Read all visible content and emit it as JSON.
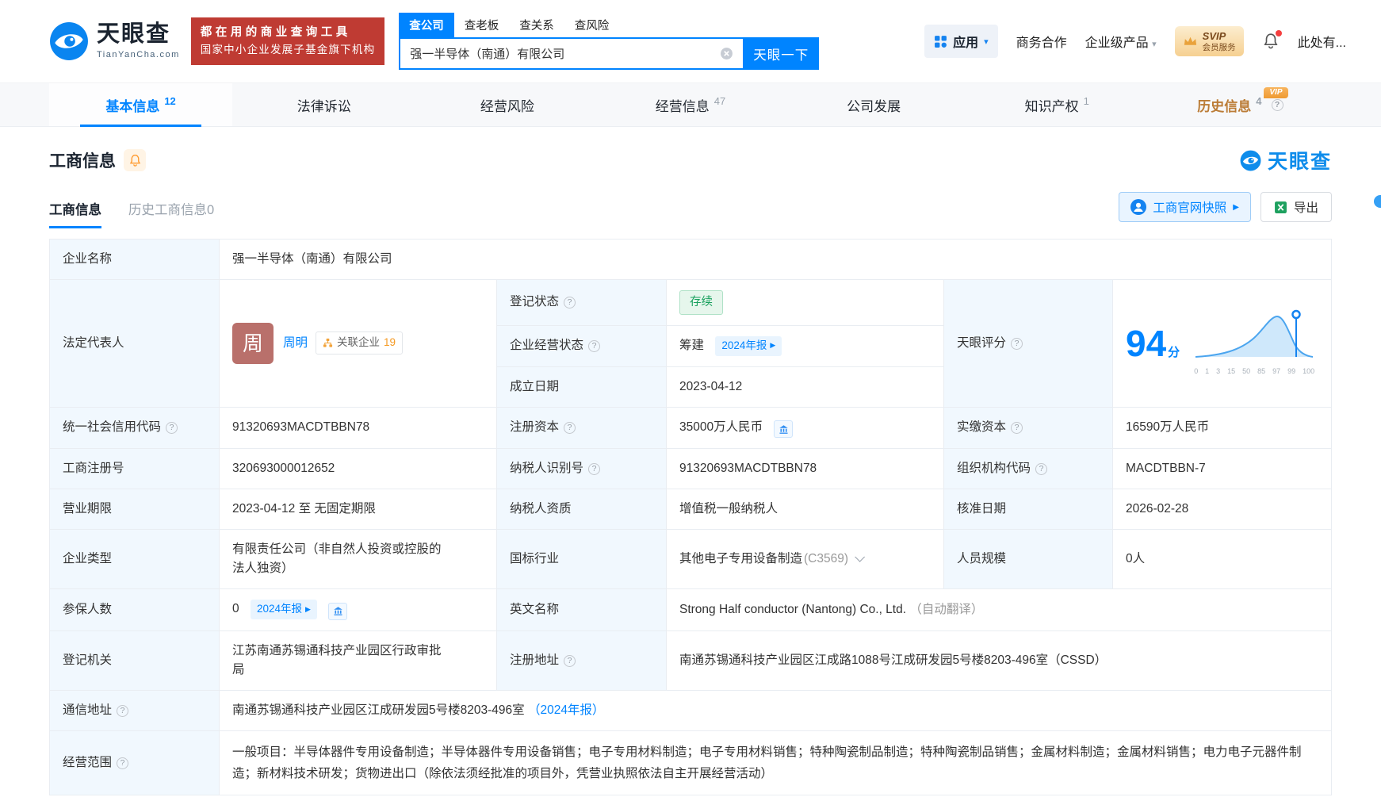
{
  "icons": {
    "help": "?",
    "caret": "▾",
    "play": "▶",
    "clear": "×"
  },
  "header": {
    "logo": {
      "cn": "天眼查",
      "en": "TianYanCha.com"
    },
    "banner": {
      "line1": "都在用的商业查询工具",
      "line2": "国家中小企业发展子基金旗下机构"
    },
    "search": {
      "tabs": [
        {
          "label": "查公司"
        },
        {
          "label": "查老板"
        },
        {
          "label": "查关系"
        },
        {
          "label": "查风险"
        }
      ],
      "value": "强一半导体（南通）有限公司",
      "button": "天眼一下"
    },
    "menu": {
      "apps": "应用",
      "cooperation": "商务合作",
      "products": "企业级产品",
      "svip_line1": "SVIP",
      "svip_line2": "会员服务",
      "more": "此处有..."
    }
  },
  "nav_tabs": [
    {
      "label": "基本信息",
      "count": "12"
    },
    {
      "label": "法律诉讼",
      "count": ""
    },
    {
      "label": "经营风险",
      "count": ""
    },
    {
      "label": "经营信息",
      "count": "47"
    },
    {
      "label": "公司发展",
      "count": ""
    },
    {
      "label": "知识产权",
      "count": "1"
    },
    {
      "label": "历史信息",
      "count": "4",
      "badge": "VIP"
    }
  ],
  "section": {
    "title": "工商信息",
    "brand": "天眼查",
    "subtabs": [
      {
        "label": "工商信息"
      },
      {
        "label": "历史工商信息0"
      }
    ],
    "snapshot_button": "工商官网快照",
    "export_button": "导出"
  },
  "info": {
    "company_name": {
      "label": "企业名称",
      "value": "强一半导体（南通）有限公司"
    },
    "legal_rep": {
      "label": "法定代表人",
      "avatar": "周",
      "name": "周明",
      "related_label": "关联企业",
      "related_count": "19"
    },
    "reg_status": {
      "label": "登记状态",
      "value": "存续"
    },
    "operating_status": {
      "label": "企业经营状态",
      "value": "筹建",
      "report_tag": "2024年报"
    },
    "establish_date": {
      "label": "成立日期",
      "value": "2023-04-12"
    },
    "score": {
      "label": "天眼评分",
      "value": "94",
      "unit": "分",
      "axis": [
        "0",
        "1",
        "3",
        "15",
        "50",
        "85",
        "97",
        "99",
        "100"
      ]
    },
    "credit_code": {
      "label": "统一社会信用代码",
      "value": "91320693MACDTBBN78"
    },
    "registered_capital": {
      "label": "注册资本",
      "value": "35000万人民币"
    },
    "paid_in_capital": {
      "label": "实缴资本",
      "value": "16590万人民币"
    },
    "registration_number": {
      "label": "工商注册号",
      "value": "320693000012652"
    },
    "taxpayer_id": {
      "label": "纳税人识别号",
      "value": "91320693MACDTBBN78"
    },
    "org_code": {
      "label": "组织机构代码",
      "value": "MACDTBBN-7"
    },
    "business_term": {
      "label": "营业期限",
      "value": "2023-04-12 至 无固定期限"
    },
    "taxpayer_qualification": {
      "label": "纳税人资质",
      "value": "增值税一般纳税人"
    },
    "approval_date": {
      "label": "核准日期",
      "value": "2026-02-28"
    },
    "company_type": {
      "label": "企业类型",
      "value": "有限责任公司（非自然人投资或控股的法人独资）"
    },
    "industry": {
      "label": "国标行业",
      "value": "其他电子专用设备制造",
      "code": "(C3569)"
    },
    "staff_size": {
      "label": "人员规模",
      "value": "0人"
    },
    "insured_count": {
      "label": "参保人数",
      "value": "0",
      "report_tag": "2024年报"
    },
    "english_name": {
      "label": "英文名称",
      "value": "Strong Half conductor (Nantong) Co., Ltd.",
      "note": "（自动翻译）"
    },
    "registration_authority": {
      "label": "登记机关",
      "value": "江苏南通苏锡通科技产业园区行政审批局"
    },
    "registered_address": {
      "label": "注册地址",
      "value": "南通苏锡通科技产业园区江成路1088号江成研发园5号楼8203-496室（CSSD）"
    },
    "postal_address": {
      "label": "通信地址",
      "value": "南通苏锡通科技产业园区江成研发园5号楼8203-496室",
      "report_link": "（2024年报）"
    },
    "business_scope": {
      "label": "经营范围",
      "value": "一般项目：半导体器件专用设备制造；半导体器件专用设备销售；电子专用材料制造；电子专用材料销售；特种陶瓷制品制造；特种陶瓷制品销售；金属材料制造；金属材料销售；电力电子元器件制造；新材料技术研发；货物进出口（除依法须经批准的项目外，凭营业执照依法自主开展经营活动）"
    }
  },
  "colors": {
    "accent": "#0084ff",
    "banner_red": "#bf3b33",
    "status_green": "#18a05d",
    "vip_orange": "#ef9a32"
  }
}
